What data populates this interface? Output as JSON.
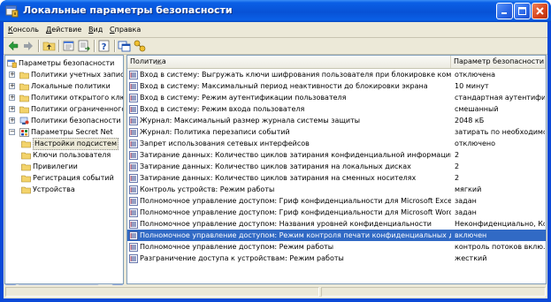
{
  "window": {
    "title": "Локальные параметры безопасности",
    "accent": "#0a49d8",
    "selection_color": "#316ac5"
  },
  "menu": {
    "items": [
      "Консоль",
      "Действие",
      "Вид",
      "Справка"
    ]
  },
  "toolbar": {
    "icons": [
      "back-icon",
      "forward-icon",
      "up-folder-icon",
      "properties-icon",
      "export-list-icon",
      "help-icon",
      "console-icon",
      "key-settings-icon"
    ]
  },
  "tree": {
    "root": "Параметры безопасности",
    "items": [
      {
        "label": "Политики учетных записей",
        "expander": "+"
      },
      {
        "label": "Локальные политики",
        "expander": "+"
      },
      {
        "label": "Политики открытого ключа",
        "expander": "+"
      },
      {
        "label": "Политики ограниченного использования программ",
        "expander": "+"
      },
      {
        "label": "Политики безопасности IP на \"Локальный компьютер\"",
        "expander": "+"
      },
      {
        "label": "Параметры Secret Net",
        "expander": "−"
      }
    ],
    "children": [
      {
        "label": "Настройки подсистем",
        "selected": true
      },
      {
        "label": "Ключи пользователя"
      },
      {
        "label": "Привилегии"
      },
      {
        "label": "Регистрация событий"
      },
      {
        "label": "Устройства"
      }
    ]
  },
  "list": {
    "headers": {
      "policy": "Политика",
      "setting": "Параметр безопасности"
    },
    "rows": [
      {
        "policy": "Вход в систему: Выгружать ключи шифрования пользователя при блокировке компьютера",
        "setting": "отключена"
      },
      {
        "policy": "Вход в систему: Максимальный период неактивности до блокировки экрана",
        "setting": "10 минут"
      },
      {
        "policy": "Вход в систему: Режим аутентификации пользователя",
        "setting": "стандартная аутентифи..."
      },
      {
        "policy": "Вход в систему: Режим входа пользователя",
        "setting": "смешанный"
      },
      {
        "policy": "Журнал: Максимальный размер журнала системы защиты",
        "setting": "2048 кБ"
      },
      {
        "policy": "Журнал: Политика перезаписи событий",
        "setting": "затирать по необходимо..."
      },
      {
        "policy": "Запрет использования сетевых интерфейсов",
        "setting": "отключено"
      },
      {
        "policy": "Затирание данных: Количество циклов затирания конфиденциальной информации",
        "setting": "2"
      },
      {
        "policy": "Затирание данных: Количество циклов затирания на локальных дисках",
        "setting": "2"
      },
      {
        "policy": "Затирание данных: Количество циклов затирания на сменных носителях",
        "setting": "2"
      },
      {
        "policy": "Контроль устройств: Режим работы",
        "setting": "мягкий"
      },
      {
        "policy": "Полномочное управление доступом: Гриф конфиденциальности для Microsoft Excel",
        "setting": "задан"
      },
      {
        "policy": "Полномочное управление доступом: Гриф конфиденциальности для Microsoft Word",
        "setting": "задан"
      },
      {
        "policy": "Полномочное управление доступом: Названия уровней конфиденциальности",
        "setting": "Неконфиденциально, Ко..."
      },
      {
        "policy": "Полномочное управление доступом: Режим контроля печати конфиденциальных документов",
        "setting": "включен",
        "selected": true
      },
      {
        "policy": "Полномочное управление доступом: Режим работы",
        "setting": "контроль потоков вклю..."
      },
      {
        "policy": "Разграничение доступа к устройствам: Режим работы",
        "setting": "жесткий"
      }
    ]
  }
}
